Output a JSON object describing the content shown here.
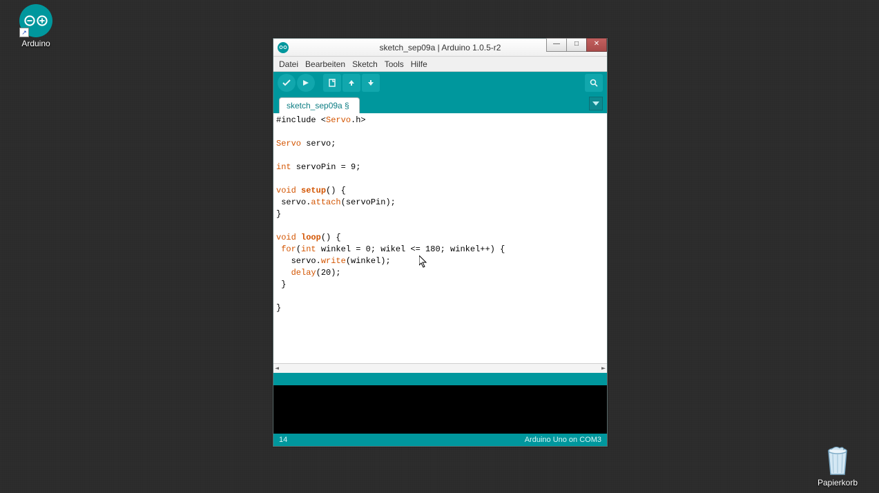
{
  "desktop": {
    "arduino_label": "Arduino",
    "trash_label": "Papierkorb"
  },
  "window": {
    "title": "sketch_sep09a | Arduino 1.0.5-r2",
    "menu": {
      "file": "Datei",
      "edit": "Bearbeiten",
      "sketch": "Sketch",
      "tools": "Tools",
      "help": "Hilfe"
    },
    "tab_label": "sketch_sep09a §",
    "status_left": "14",
    "status_right": "Arduino Uno on COM3",
    "scroll_left": "◄",
    "scroll_right": "►"
  },
  "code": {
    "l1a": "#include <",
    "l1b": "Servo",
    "l1c": ".h>",
    "l3a": "Servo",
    "l3b": " servo;",
    "l5a": "int",
    "l5b": " servoPin = 9;",
    "l7a": "void",
    "l7b": " ",
    "l7c": "setup",
    "l7d": "() {",
    "l8a": " servo.",
    "l8b": "attach",
    "l8c": "(servoPin);",
    "l9": "}",
    "l11a": "void",
    "l11b": " ",
    "l11c": "loop",
    "l11d": "() {",
    "l12a": " ",
    "l12b": "for",
    "l12c": "(",
    "l12d": "int",
    "l12e": " winkel = 0; wikel <= 180; winkel++) {",
    "l13a": "   servo.",
    "l13b": "write",
    "l13c": "(winkel);",
    "l14a": "   ",
    "l14b": "delay",
    "l14c": "(20);",
    "l15": " }",
    "l17": "}"
  }
}
